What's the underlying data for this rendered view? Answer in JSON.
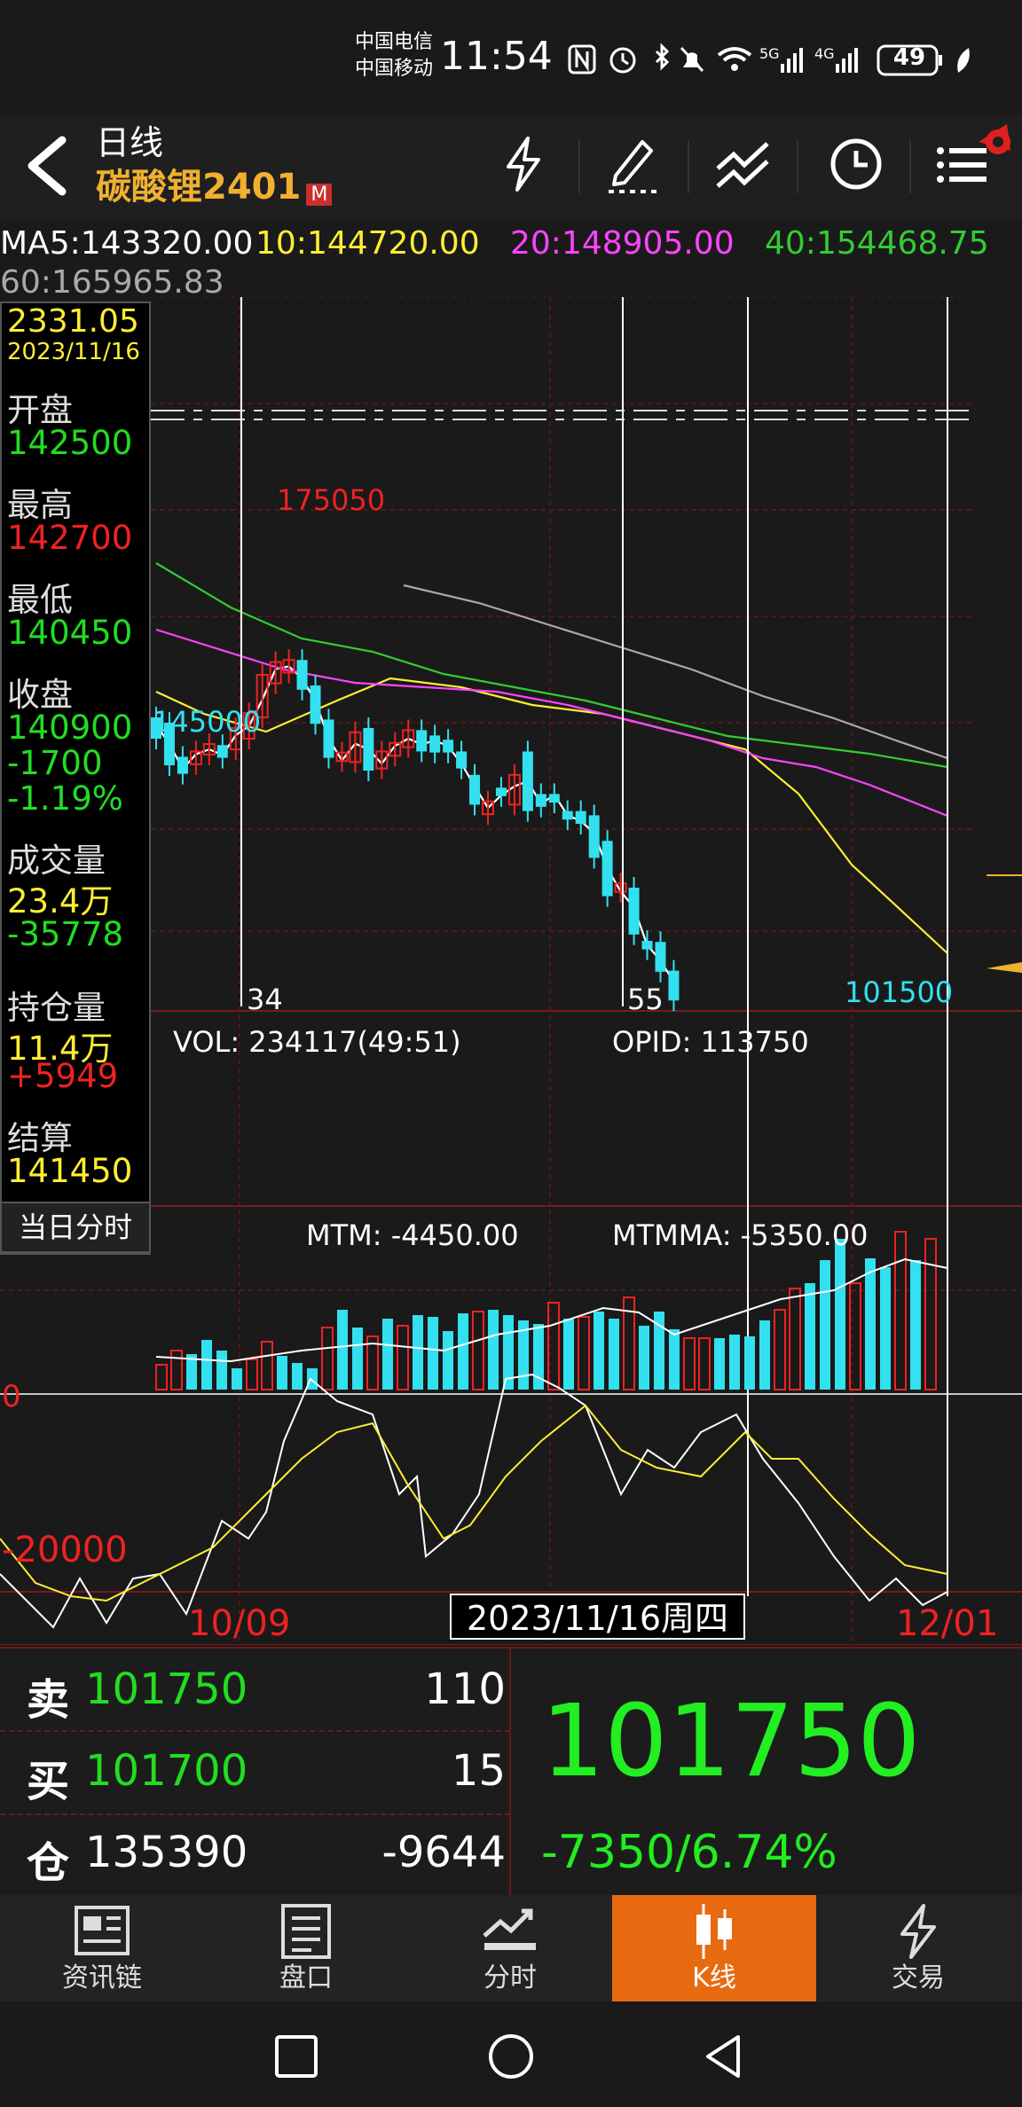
{
  "status_bar": {
    "carrier1": "中国电信",
    "carrier2": "中国移动",
    "time": "11:54",
    "battery": "49"
  },
  "header": {
    "period": "日线",
    "symbol": "碳酸锂2401",
    "badge": "M"
  },
  "ma_line": {
    "ma5": "MA5:143320.00",
    "ma10": "10:144720.00",
    "ma20": "20:148905.00",
    "ma40": "40:154468.75",
    "ma60": "60:165965.83"
  },
  "info_panel": {
    "price": "2331.05",
    "date": "2023/11/16",
    "open_label": "开盘",
    "open_value": "142500",
    "high_label": "最高",
    "high_value": "142700",
    "low_label": "最低",
    "low_value": "140450",
    "close_label": "收盘",
    "close_value": "140900",
    "change": "-1700",
    "change_pct": "-1.19%",
    "volume_label": "成交量",
    "volume_value": "23.4万",
    "volume_change": "-35778",
    "oi_label": "持仓量",
    "oi_value": "11.4万",
    "oi_change": "+5949",
    "settle_label": "结算",
    "settle_value": "141450",
    "intraday_button": "当日分时"
  },
  "chart_labels": {
    "high_mark": "175050",
    "low_mark_left": "145000",
    "low_mark_right": "101500",
    "bar_count_1": "34",
    "bar_count_2": "55",
    "vol_label": "VOL: 234117(49:51)",
    "opid_label": "OPID: 113750",
    "mtm_label": "MTM: -4450.00",
    "mtmma_label": "MTMMA: -5350.00",
    "mtm_zero": "0",
    "mtm_neg": "-20000",
    "date_left": "10/09",
    "date_cursor": "2023/11/16周四",
    "date_right": "12/01"
  },
  "quote": {
    "sell_label": "卖",
    "sell_price": "101750",
    "sell_vol": "110",
    "buy_label": "买",
    "buy_price": "101700",
    "buy_vol": "15",
    "oi_label": "仓",
    "oi_value": "135390",
    "oi_change": "-9644",
    "last_price": "101750",
    "last_change": "-7350/6.74%"
  },
  "nav": {
    "items": [
      "资讯链",
      "盘口",
      "分时",
      "K线",
      "交易"
    ],
    "active": "K线"
  },
  "colors": {
    "up": "#ee2222",
    "down": "#33e0f0",
    "active_tab": "#e86a10",
    "ma5": "#ffffff",
    "ma10": "#ffee33",
    "ma20": "#ff44ff",
    "ma40": "#33cc33",
    "ma60": "#aaaaaa"
  }
}
